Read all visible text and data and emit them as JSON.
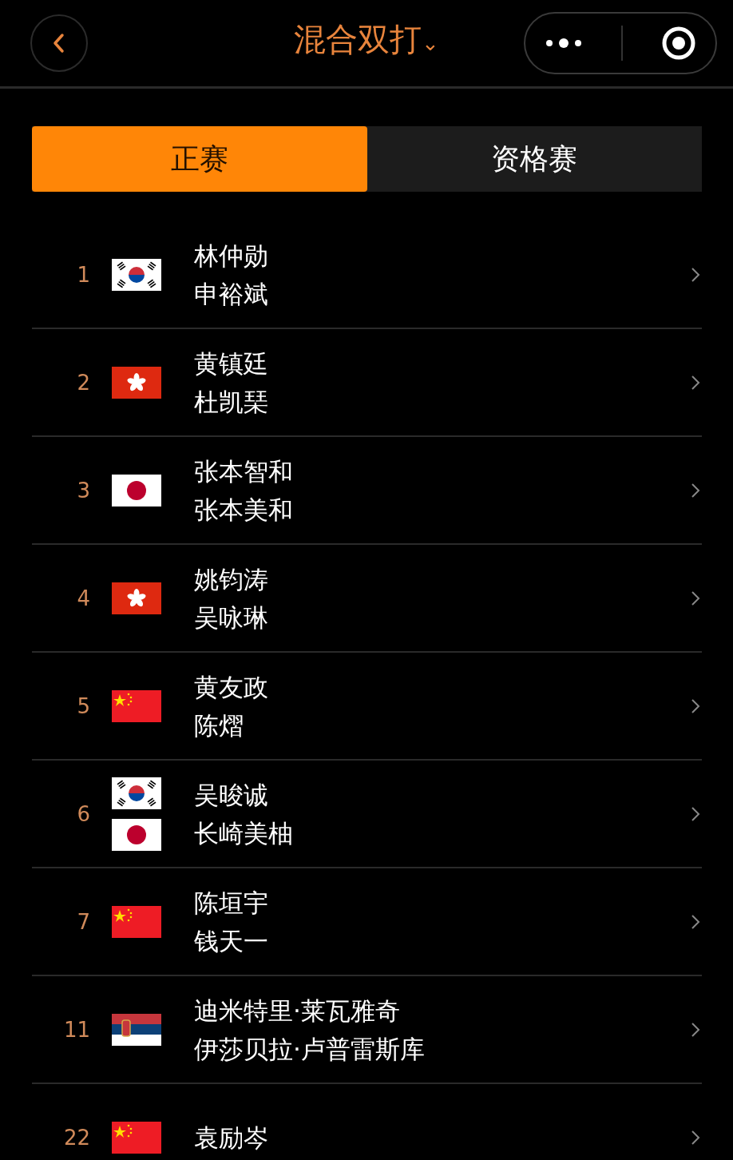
{
  "header": {
    "title": "混合双打",
    "title_caret": "⌄"
  },
  "tabs": [
    {
      "label": "正赛",
      "selected": true
    },
    {
      "label": "资格赛",
      "selected": false
    }
  ],
  "rows": [
    {
      "rank": "1",
      "flags": [
        {
          "kind": "kr"
        }
      ],
      "players": [
        "林仲勋",
        "申裕斌"
      ]
    },
    {
      "rank": "2",
      "flags": [
        {
          "kind": "hk"
        }
      ],
      "players": [
        "黄镇廷",
        "杜凯琹"
      ]
    },
    {
      "rank": "3",
      "flags": [
        {
          "kind": "jp"
        }
      ],
      "players": [
        "张本智和",
        "张本美和"
      ]
    },
    {
      "rank": "4",
      "flags": [
        {
          "kind": "hk"
        }
      ],
      "players": [
        "姚钧涛",
        "吴咏琳"
      ]
    },
    {
      "rank": "5",
      "flags": [
        {
          "kind": "cn"
        }
      ],
      "players": [
        "黄友政",
        "陈熠"
      ]
    },
    {
      "rank": "6",
      "flags": [
        {
          "kind": "kr"
        },
        {
          "kind": "jp"
        }
      ],
      "players": [
        "吴晙诚",
        "长崎美柚"
      ]
    },
    {
      "rank": "7",
      "flags": [
        {
          "kind": "cn"
        }
      ],
      "players": [
        "陈垣宇",
        "钱天一"
      ]
    },
    {
      "rank": "11",
      "flags": [
        {
          "kind": "rs"
        }
      ],
      "players": [
        "迪米特里·莱瓦雅奇",
        "伊莎贝拉·卢普雷斯库"
      ]
    },
    {
      "rank": "22",
      "flags": [
        {
          "kind": "cn"
        }
      ],
      "players": [
        "袁励岑"
      ]
    }
  ]
}
